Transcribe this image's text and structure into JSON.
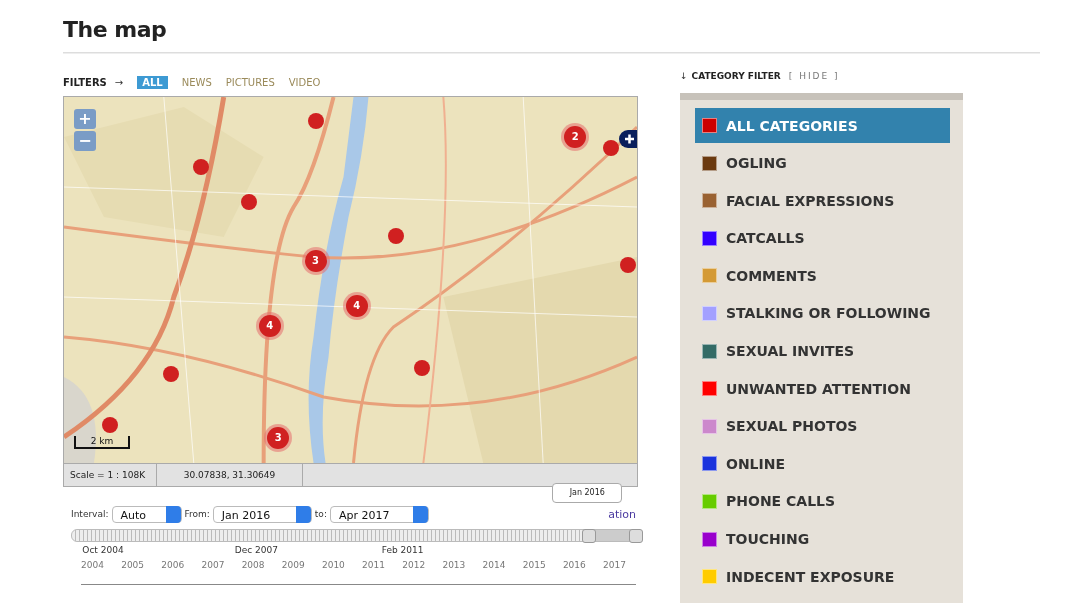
{
  "page_title": "The map",
  "filters": {
    "label": "FILTERS",
    "arrow": "→",
    "tabs": [
      {
        "label": "ALL",
        "selected": true
      },
      {
        "label": "NEWS",
        "selected": false
      },
      {
        "label": "PICTURES",
        "selected": false
      },
      {
        "label": "VIDEO",
        "selected": false
      }
    ]
  },
  "map": {
    "zoom_in": "+",
    "zoom_out": "−",
    "scale_bar": "2 km",
    "markers": [
      {
        "kind": "point"
      },
      {
        "kind": "cluster",
        "count": "2"
      },
      {
        "kind": "point"
      },
      {
        "kind": "point"
      },
      {
        "kind": "point"
      },
      {
        "kind": "point"
      },
      {
        "kind": "cluster",
        "count": "3"
      },
      {
        "kind": "point"
      },
      {
        "kind": "cluster",
        "count": "4"
      },
      {
        "kind": "cluster",
        "count": "4"
      },
      {
        "kind": "point"
      },
      {
        "kind": "point"
      },
      {
        "kind": "point"
      },
      {
        "kind": "cluster",
        "count": "3"
      }
    ],
    "status": {
      "scale": "Scale = 1 : 108K",
      "coordinates": "30.07838, 31.30649"
    }
  },
  "timeline": {
    "interval_label": "Interval:",
    "interval": "Auto",
    "from_label": "From:",
    "from": "Jan 2016",
    "to_label": "to:",
    "to": "Apr 2017",
    "tooltip": "Jan 2016",
    "link": "ation",
    "handles": [
      {
        "level": 0.917
      },
      {
        "level": 1
      }
    ],
    "marks": [
      "Oct 2004",
      "Dec 2007",
      "Feb 2011"
    ],
    "years": [
      "2004",
      "2005",
      "2006",
      "2007",
      "2008",
      "2009",
      "2010",
      "2011",
      "2012",
      "2013",
      "2014",
      "2015",
      "2016",
      "2017"
    ]
  },
  "category_filter": {
    "arrow": "↓",
    "title": "CATEGORY FILTER",
    "hide": "[ HIDE ]",
    "items": [
      {
        "label": "ALL CATEGORIES",
        "color": "#cc0000",
        "selected": true
      },
      {
        "label": "OGLING",
        "color": "#6b3a10",
        "selected": false
      },
      {
        "label": "FACIAL EXPRESSIONS",
        "color": "#9a6232",
        "selected": false
      },
      {
        "label": "CATCALLS",
        "color": "#3300ff",
        "selected": false
      },
      {
        "label": "COMMENTS",
        "color": "#d49a35",
        "selected": false
      },
      {
        "label": "STALKING OR FOLLOWING",
        "color": "#a3a0ff",
        "selected": false
      },
      {
        "label": "SEXUAL INVITES",
        "color": "#336b66",
        "selected": false
      },
      {
        "label": "UNWANTED ATTENTION",
        "color": "#ff0000",
        "selected": false
      },
      {
        "label": "SEXUAL PHOTOS",
        "color": "#cc88cc",
        "selected": false
      },
      {
        "label": "ONLINE",
        "color": "#1a33dd",
        "selected": false
      },
      {
        "label": "PHONE CALLS",
        "color": "#66cc00",
        "selected": false
      },
      {
        "label": "TOUCHING",
        "color": "#9900cc",
        "selected": false
      },
      {
        "label": "INDECENT EXPOSURE",
        "color": "#ffcc00",
        "selected": false
      }
    ]
  }
}
